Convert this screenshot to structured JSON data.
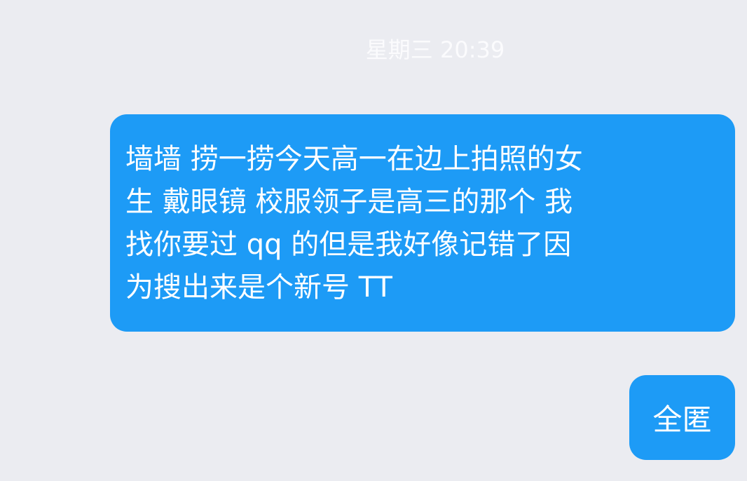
{
  "chat": {
    "timestamp": "星期三 20:39",
    "accent_color": "#1d9bf6",
    "messages": [
      {
        "direction": "outgoing",
        "lines": [
          "墙墙 捞一捞今天高一在边上拍照的女",
          "生 戴眼镜 校服领子是高三的那个 我",
          "找你要过 qq 的但是我好像记错了因",
          "为搜出来是个新号 TT"
        ]
      },
      {
        "direction": "outgoing",
        "text": "全匿"
      }
    ]
  }
}
